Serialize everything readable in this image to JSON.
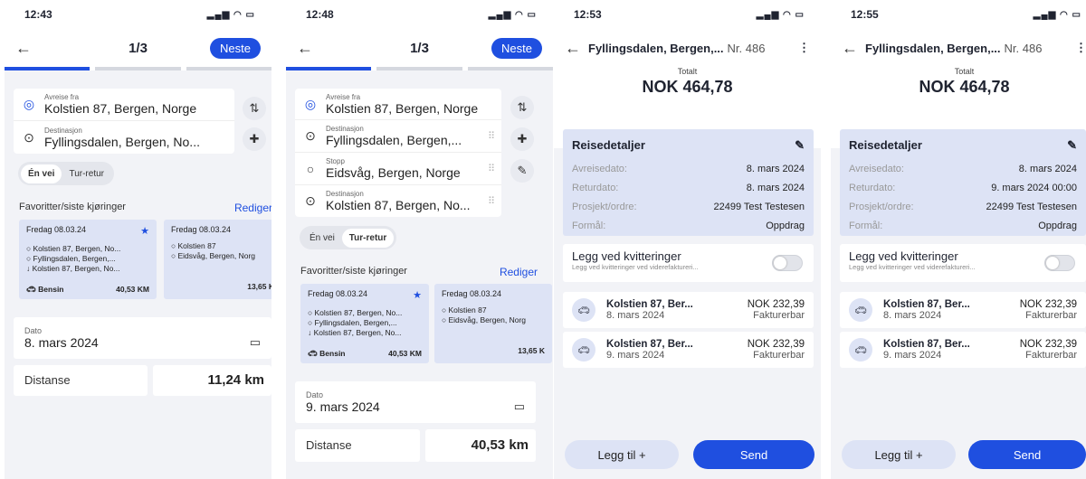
{
  "screens": [
    {
      "time": "12:43",
      "status_icons": "▂▄▆ ◠ ▭",
      "step": "1/3",
      "next": "Neste",
      "from_label": "Avreise fra",
      "from_value": "Kolstien 87, Bergen, Norge",
      "dest_label": "Destinasjon",
      "dest_value": "Fyllingsdalen, Bergen, No...",
      "toggle_oneway": "Én vei",
      "toggle_return": "Tur-retur",
      "fav_header": "Favoritter/siste kjøringer",
      "edit": "Rediger",
      "card1": {
        "date": "Fredag 08.03.24",
        "l1": "Kolstien 87, Bergen, No...",
        "l2": "Fyllingsdalen, Bergen,...",
        "l3": "Kolstien 87, Bergen, No...",
        "fuel": "Bensin",
        "km": "40,53 KM"
      },
      "card2": {
        "date": "Fredag 08.03.24",
        "l1": "Kolstien 87",
        "l2": "Eidsvåg, Bergen, Norg",
        "km": "13,65 K"
      },
      "date_label": "Dato",
      "date_value": "8. mars 2024",
      "distance_label": "Distanse",
      "distance_value": "11,24 km"
    },
    {
      "time": "12:48",
      "status_icons": "▂▄▆ ◠ ▭",
      "step": "1/3",
      "next": "Neste",
      "from_label": "Avreise fra",
      "from_value": "Kolstien 87, Bergen, Norge",
      "dest1_label": "Destinasjon",
      "dest1_value": "Fyllingsdalen, Bergen,...",
      "stop_label": "Stopp",
      "stop_value": "Eidsvåg, Bergen, Norge",
      "dest2_label": "Destinasjon",
      "dest2_value": "Kolstien 87, Bergen, No...",
      "toggle_oneway": "Én vei",
      "toggle_return": "Tur-retur",
      "fav_header": "Favoritter/siste kjøringer",
      "edit": "Rediger",
      "card1": {
        "date": "Fredag 08.03.24",
        "l1": "Kolstien 87, Bergen, No...",
        "l2": "Fyllingsdalen, Bergen,...",
        "l3": "Kolstien 87, Bergen, No...",
        "fuel": "Bensin",
        "km": "40,53 KM"
      },
      "card2": {
        "date": "Fredag 08.03.24",
        "l1": "Kolstien 87",
        "l2": "Eidsvåg, Bergen, Norg",
        "km": "13,65 K"
      },
      "date_label": "Dato",
      "date_value": "9. mars 2024",
      "distance_label": "Distanse",
      "distance_value": "40,53 km"
    },
    {
      "time": "12:53",
      "status_icons": "▂▄▆ ◠ ▭",
      "title": "Fyllingsdalen, Bergen,...",
      "nr": "Nr. 486",
      "total_label": "Totalt",
      "total_value": "NOK 464,78",
      "details_title": "Reisedetaljer",
      "rows": [
        {
          "k": "Avreisedato:",
          "v": "8. mars 2024"
        },
        {
          "k": "Returdato:",
          "v": "8. mars 2024"
        },
        {
          "k": "Prosjekt/ordre:",
          "v": "22499 Test Testesen"
        },
        {
          "k": "Formål:",
          "v": "Oppdrag"
        }
      ],
      "receipt_title": "Legg ved kvitteringer",
      "receipt_sub": "Legg ved kvitteringer ved viderefaktureri...",
      "trips": [
        {
          "addr": "Kolstien 87, Ber...",
          "date": "8. mars 2024",
          "amount": "NOK 232,39",
          "status": "Fakturerbar"
        },
        {
          "addr": "Kolstien 87, Ber...",
          "date": "9. mars 2024",
          "amount": "NOK 232,39",
          "status": "Fakturerbar"
        }
      ],
      "add": "Legg til  +",
      "send": "Send"
    },
    {
      "time": "12:55",
      "status_icons": "▂▄▆ ◠ ▭",
      "title": "Fyllingsdalen, Bergen,...",
      "nr": "Nr. 486",
      "total_label": "Totalt",
      "total_value": "NOK 464,78",
      "details_title": "Reisedetaljer",
      "rows": [
        {
          "k": "Avreisedato:",
          "v": "8. mars 2024"
        },
        {
          "k": "Returdato:",
          "v": "9. mars 2024 00:00"
        },
        {
          "k": "Prosjekt/ordre:",
          "v": "22499 Test Testesen"
        },
        {
          "k": "Formål:",
          "v": "Oppdrag"
        }
      ],
      "receipt_title": "Legg ved kvitteringer",
      "receipt_sub": "Legg ved kvitteringer ved viderefaktureri...",
      "trips": [
        {
          "addr": "Kolstien 87, Ber...",
          "date": "8. mars 2024",
          "amount": "NOK 232,39",
          "status": "Fakturerbar"
        },
        {
          "addr": "Kolstien 87, Ber...",
          "date": "9. mars 2024",
          "amount": "NOK 232,39",
          "status": "Fakturerbar"
        }
      ],
      "add": "Legg til  +",
      "send": "Send"
    }
  ]
}
